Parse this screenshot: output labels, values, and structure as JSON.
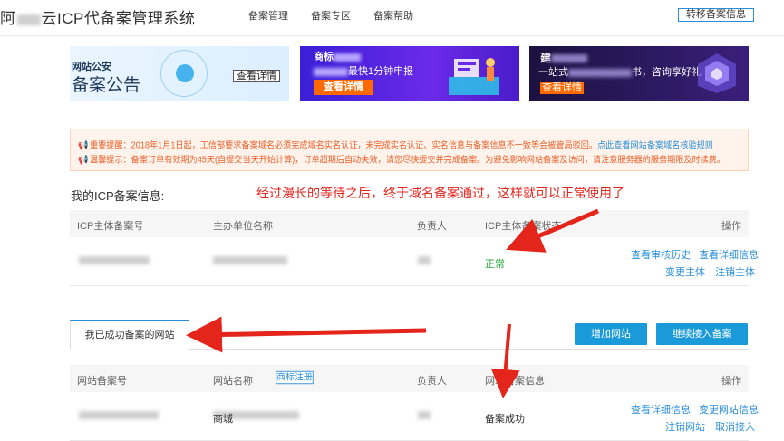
{
  "header": {
    "brand": "ICP代备案管理系统",
    "brand_prefix_visible": "阿",
    "brand_suffix_visible": "云",
    "nav": [
      "备案管理",
      "备案专区",
      "备案帮助"
    ],
    "transfer_button": "转移备案信息"
  },
  "banners": {
    "b1_small": "网站公安",
    "b1_big": "备案公告",
    "b1_button": "查看详情",
    "b2_title": "商标",
    "b2_line": "最快1分钟申报",
    "b2_button": "查看详情",
    "b3_title": "建",
    "b3_line_a": "一站式",
    "b3_line_b": "书，咨询享好礼",
    "b3_button": "查看详情"
  },
  "notice": {
    "line1_label": "重要提醒：",
    "line1_text": "2018年1月1日起，工信部要求备案域名必须完成域名实名认证，未完成实名认证、实名信息与备案信息不一致等会被管局驳回。",
    "line1_link": "点此查看网站备案域名核验规则",
    "line2_label": "温馨提示：",
    "line2_text": "备案订单有效期为45天(自提交当天开始计算)，订单超期后自动失效，请您尽快提交并完成备案。为避免影响网站备案及访问，请注意服务器的服务期限及时续费。"
  },
  "icp_section": {
    "title": "我的ICP备案信息:",
    "annotation": "经过漫长的等待之后，终于域名备案通过，这样就可以正常使用了",
    "columns": [
      "ICP主体备案号",
      "主办单位名称",
      "负责人",
      "ICP主体备案状态",
      "操作"
    ],
    "row": {
      "status": "正常",
      "op_history": "查看审核历史",
      "op_detail": "查看详细信息",
      "op_change": "变更主体",
      "op_cancel": "注销主体"
    }
  },
  "sites_section": {
    "tab": "我已成功备案的网站",
    "add_button": "增加网站",
    "continue_button": "继续接入备案",
    "columns": [
      "网站备案号",
      "网站名称",
      "负责人",
      "网站备案信息",
      "操作"
    ],
    "trademark_button": "商标注册",
    "row": {
      "name_suffix": "商城",
      "status": "备案成功",
      "op_detail": "查看详细信息",
      "op_change": "变更网站信息",
      "op_cancel": "注销网站",
      "op_remove": "取消接入"
    }
  },
  "colors": {
    "accent": "#1a9ad9",
    "link": "#2a8fd8",
    "notice_text": "#e8632d",
    "status_ok": "#2aa640",
    "annotation_red": "#e3251c"
  }
}
